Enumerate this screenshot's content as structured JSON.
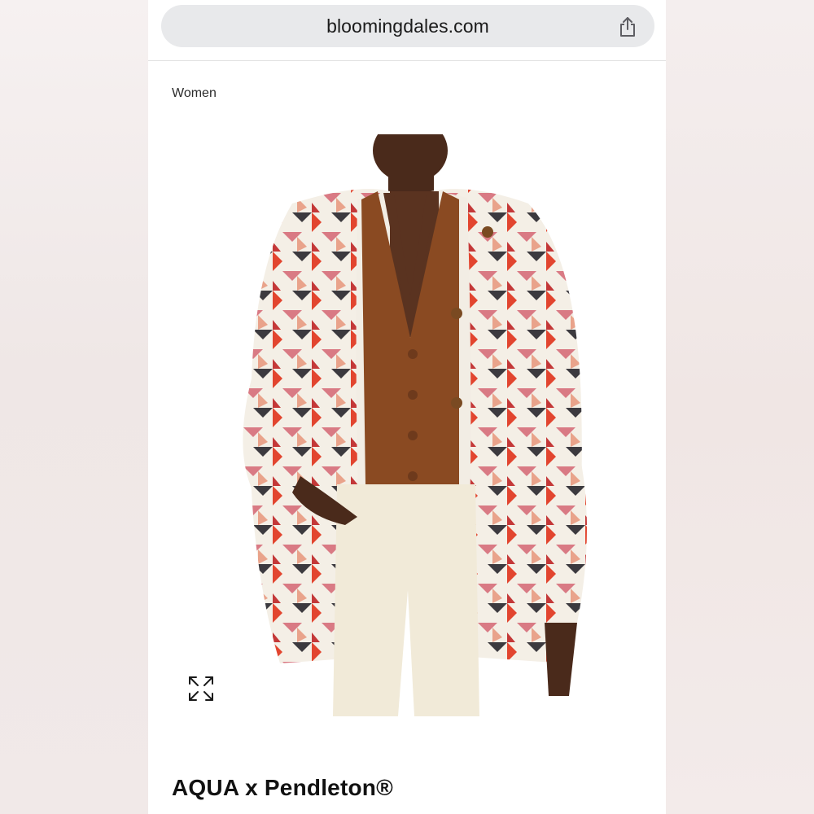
{
  "browser": {
    "url": "bloomingdales.com",
    "share_icon": "share-icon"
  },
  "breadcrumb": {
    "label": "Women"
  },
  "product": {
    "image_alt": "Model wearing a quilted cream jacket with geometric red, pink and charcoal pattern over a brown cardigan and cream pants",
    "expand_icon": "expand-icon",
    "brand": "AQUA x Pendleton®"
  },
  "colors": {
    "jacket_base": "#f4efe6",
    "pattern_red": "#e2452f",
    "pattern_pink": "#d97a84",
    "pattern_charcoal": "#3c3a3f",
    "cardigan": "#8a4a22",
    "pants": "#f1ead8"
  }
}
